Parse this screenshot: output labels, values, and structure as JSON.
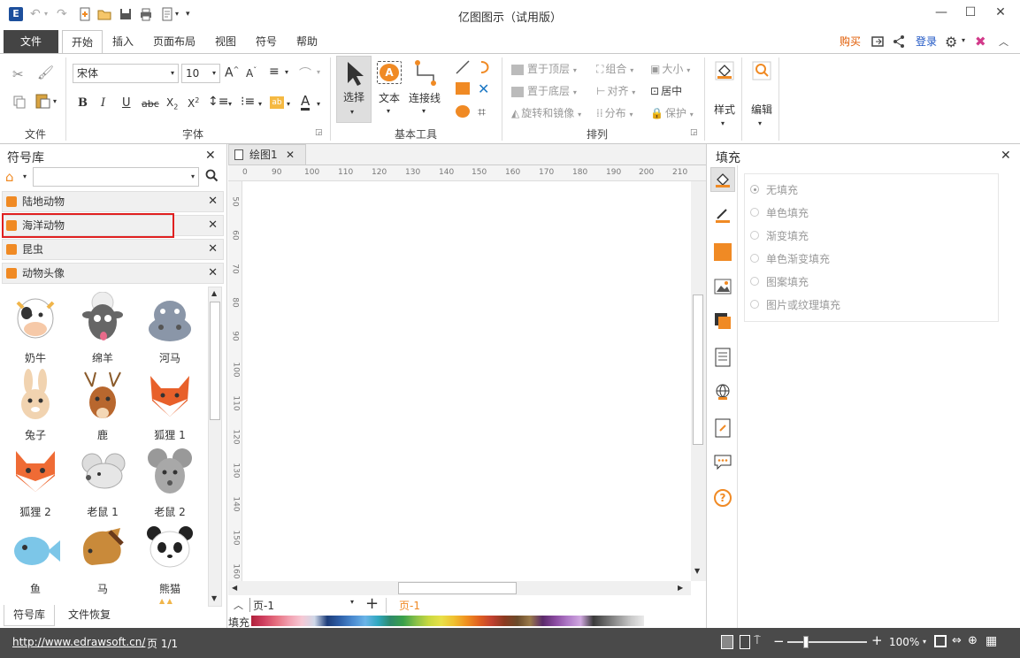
{
  "window": {
    "title": "亿图图示（试用版）"
  },
  "tabs": [
    {
      "label": "文件"
    },
    {
      "label": "开始"
    },
    {
      "label": "插入"
    },
    {
      "label": "页面布局"
    },
    {
      "label": "视图"
    },
    {
      "label": "符号"
    },
    {
      "label": "帮助"
    }
  ],
  "account": {
    "buy": "购买",
    "login": "登录"
  },
  "ribbon": {
    "groups": {
      "file": "文件",
      "font": "字体",
      "basic_tools": "基本工具",
      "arrange": "排列"
    },
    "font_name": "宋体",
    "font_size": "10",
    "tools": {
      "select": "选择",
      "text": "文本",
      "connector": "连接线"
    },
    "arrange": {
      "bring_front": "置于顶层",
      "send_back": "置于底层",
      "rotate_mirror": "旋转和镜像",
      "group": "组合",
      "align": "对齐",
      "distribute": "分布",
      "size": "大小",
      "center": "居中",
      "protect": "保护"
    },
    "style": "样式",
    "edit": "编辑"
  },
  "library": {
    "title": "符号库",
    "categories": [
      {
        "label": "陆地动物"
      },
      {
        "label": "海洋动物"
      },
      {
        "label": "昆虫"
      },
      {
        "label": "动物头像"
      }
    ],
    "shapes": [
      {
        "label": "奶牛"
      },
      {
        "label": "绵羊"
      },
      {
        "label": "河马"
      },
      {
        "label": "兔子"
      },
      {
        "label": "鹿"
      },
      {
        "label": "狐狸 1"
      },
      {
        "label": "狐狸 2"
      },
      {
        "label": "老鼠 1"
      },
      {
        "label": "老鼠 2"
      },
      {
        "label": "鱼"
      },
      {
        "label": "马"
      },
      {
        "label": "熊猫"
      }
    ],
    "bottom_tabs": {
      "library": "符号库",
      "recovery": "文件恢复"
    }
  },
  "document": {
    "tab": "绘图1",
    "ruler_h": [
      "0",
      "90",
      "100",
      "110",
      "120",
      "130",
      "140",
      "150",
      "160",
      "170",
      "180",
      "190",
      "200",
      "210"
    ],
    "ruler_v": [
      "50",
      "60",
      "70",
      "80",
      "90",
      "100",
      "110",
      "120",
      "130",
      "140",
      "150",
      "160"
    ],
    "page_select": "页-1",
    "page_tab": "页-1",
    "fill_label": "填充"
  },
  "fill_panel": {
    "title": "填充",
    "options": [
      "无填充",
      "单色填充",
      "渐变填充",
      "单色渐变填充",
      "图案填充",
      "图片或纹理填充"
    ]
  },
  "status": {
    "url": "http://www.edrawsoft.cn/",
    "page": "页 1/1",
    "zoom": "100%"
  },
  "colors": {
    "accent": "#f08a24",
    "highlight": "#e02020",
    "status_bg": "#4a4a4a"
  }
}
